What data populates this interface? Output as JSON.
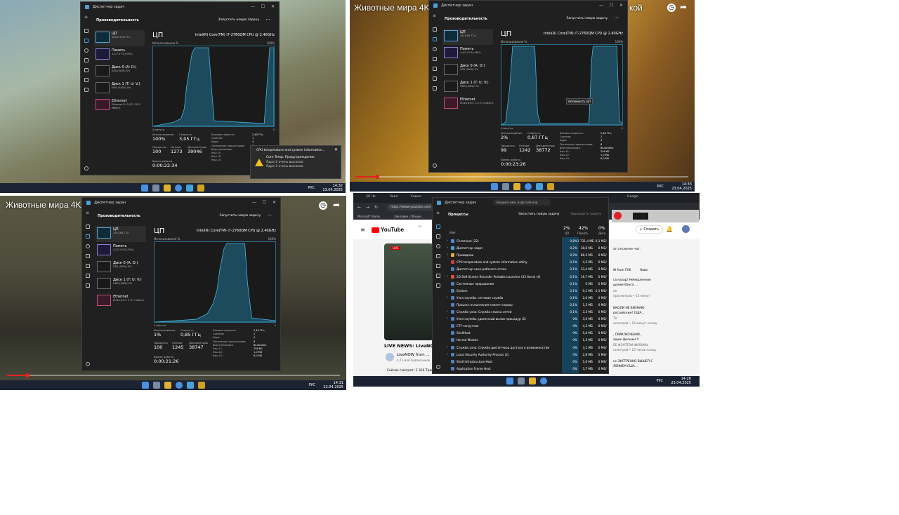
{
  "task_manager": {
    "app_name": "Диспетчер задач",
    "page_performance": "Производительность",
    "page_processes": "Процессы",
    "run_new_task": "Запустить новую задачу",
    "end_task": "Завершить задачу",
    "more": "···",
    "cpu_heading": "ЦП",
    "cpu_name": "Intel(R) Core(TM) i7-2760QM CPU @ 2.40GHz",
    "utilization_label": "Использование %",
    "pct_100": "100%",
    "pct_0": "0",
    "time_axis": "4 минуты",
    "stat_labels": {
      "usage": "Использование",
      "speed": "Скорость",
      "processes": "Процессы",
      "threads": "Потоки",
      "handles": "Дескрипторы",
      "uptime": "Время работы"
    },
    "spec_labels": [
      "Базовая скорость:",
      "Сокетов:",
      "Ядра:",
      "Логических процессоров:",
      "Виртуализация:",
      "Кэш L1:",
      "Кэш L2:",
      "Кэш L3:"
    ],
    "spec_values": [
      "2,40 ГГц",
      "1",
      "4",
      "8",
      "Включено",
      "256 КБ",
      "1,0 МБ",
      "6,0 МБ"
    ]
  },
  "screens": [
    {
      "side_items": [
        {
          "label": "ЦП",
          "sub": "100% 3,05 ГГц"
        },
        {
          "label": "Память",
          "sub": "4,2/7,9 ГБ (53%)"
        },
        {
          "label": "Диск 0 (A: D:)",
          "sub": "SSD (SATA) 0%"
        },
        {
          "label": "Диск 1 (T: U: V:)",
          "sub": "HDD (SATA) 0%"
        },
        {
          "label": "Ethernet",
          "sub": "Ethernet О: 0,0 П: 30,5 Мбит/с"
        }
      ],
      "usage": "100%",
      "speed": "3,05 ГГц",
      "processes": "100",
      "threads": "1273",
      "handles": "39046",
      "uptime": "0:00:22:34",
      "toast": {
        "title": "CPU temperature and system information...",
        "heading": "Core Temp: Предупреждение",
        "line1": "Ядро 2 очень высокая.",
        "line2": "Ядро 3 очень высокая."
      },
      "tray": {
        "lang": "РУС",
        "time": "14:32",
        "date": "23.04.2025"
      }
    },
    {
      "video_title": "Животные мира 4K - За",
      "video_title_tail": "кой",
      "side_items": [
        {
          "label": "ЦП",
          "sub": "2% 0,87 ГГц"
        },
        {
          "label": "Память",
          "sub": "4,4/7,9 ГБ (56%)"
        },
        {
          "label": "Диск 0 (A: D:)",
          "sub": "SSD (SATA) 1%"
        },
        {
          "label": "Диск 1 (T: U: V:)",
          "sub": "HDD (SATA) 0%"
        },
        {
          "label": "Ethernet",
          "sub": "Ethernet О: 0,0 П: 0 кбит/с"
        }
      ],
      "usage": "2%",
      "speed": "0,87 ГГц",
      "processes": "99",
      "threads": "1242",
      "handles": "38772",
      "uptime": "0:00:23:26",
      "tooltip": "Активность ЦП",
      "tray": {
        "lang": "РУС",
        "time": "14:33",
        "date": "23.04.2025"
      }
    },
    {
      "video_title": "Животные мира 4K - За",
      "side_items": [
        {
          "label": "ЦП",
          "sub": "1% 0,85 ГГц"
        },
        {
          "label": "Память",
          "sub": "4,2/7,9 ГБ (53%)"
        },
        {
          "label": "Диск 0 (A: D:)",
          "sub": "SSD (SATA) 0%"
        },
        {
          "label": "Диск 1 (T: U: V:)",
          "sub": "HDD (SATA) 0%"
        },
        {
          "label": "Ethernet",
          "sub": "Ethernet О: 0 П: 0 кбит/с"
        }
      ],
      "usage": "1%",
      "speed": "0,85 ГГц",
      "processes": "100",
      "threads": "1245",
      "handles": "38747",
      "uptime": "0:00:21:26",
      "tray": {
        "lang": "РУС",
        "time": "14:31",
        "date": "23.04.2025"
      }
    },
    {
      "browser": {
        "tabs": [
          "(2) Че",
          "Закл",
          "Самол",
          "Диспетчер задач",
          "Google"
        ],
        "url": "https://www.youtube.com",
        "search_placeholder": "Введите имя, издателя или",
        "bookmarks": [
          "Microsoft Teams",
          "Закладки | Общие..."
        ]
      },
      "youtube": {
        "logo": "YouTube",
        "region": "UA",
        "create": "+ Создать",
        "live": "LIVE",
        "video_title": "LIVE NEWS: LiveNOW",
        "channel": "LiveNOW from ...",
        "subs": "4,73 млн подписчиков",
        "viewing": "Сейчас смотрят: 1 310  Трансляция началась 3 янв. 2024 г.",
        "side_lines": [
          "ат отключен чат.",
          "W from FOX",
          "са назад! Немедленное",
          "щание Вэнса ...",
          "ал",
          "просмотров • 15 минут",
          "ИКОЛИ НЕ ВИЗНАЮ",
          "российским! США...",
          "TV",
          "осмотров • 14 минут назад",
          ", ПРИКЛЮЧЕНИЯ,",
          "ащие фильмы!!!",
          "ЕЕ ФЭНТЕЗИ ФИЛЬМЫ",
          "осмотров • 15 часов назад",
          "нс ЭКСТРЕННО ВЫШЕЛ С",
          "ЛЕНИЕМ США..."
        ],
        "chip_new": "Ново"
      },
      "proc_headers": {
        "name": "Имя",
        "cpu_pct": "2%",
        "cpu": "ЦП",
        "mem_pct": "42%",
        "mem": "Память",
        "disk_pct": "0%",
        "disk": "Диск"
      },
      "processes": [
        {
          "name": "Chromium (22)",
          "cpu": "0,8%",
          "mem": "1 731,4 МБ",
          "disk": "0,1 МБ/с",
          "icon": "#4a8fe0",
          "exp": true
        },
        {
          "name": "Диспетчер задач",
          "cpu": "0,2%",
          "mem": "38,6 МБ",
          "disk": "0 МБ/с",
          "icon": "#4aa0d8",
          "exp": true
        },
        {
          "name": "Проводник",
          "cpu": "0,2%",
          "mem": "88,3 МБ",
          "disk": "0 МБ/с",
          "icon": "#e0b030",
          "exp": true
        },
        {
          "name": "CPU temperature and system information utility",
          "cpu": "0,1%",
          "mem": "4,2 МБ",
          "disk": "0 МБ/с",
          "icon": "#d04040",
          "exp": false
        },
        {
          "name": "Диспетчер окон рабочего стола",
          "cpu": "0,1%",
          "mem": "33,4 МБ",
          "disk": "0 МБ/с",
          "icon": "#5080c0",
          "exp": false
        },
        {
          "name": "2D Soft Screen Recorder Portable Launcher (32 бита) (4)",
          "cpu": "0,1%",
          "mem": "16,7 МБ",
          "disk": "0 МБ/с",
          "icon": "#e05030",
          "exp": true
        },
        {
          "name": "Системные прерывания",
          "cpu": "0,1%",
          "mem": "0 МБ",
          "disk": "0 МБ/с",
          "icon": "#5080c0",
          "exp": false
        },
        {
          "name": "System",
          "cpu": "0,1%",
          "mem": "0,1 МБ",
          "disk": "0,1 МБ/с",
          "icon": "#5080c0",
          "exp": false
        },
        {
          "name": "Узел службы: сетевая служба",
          "cpu": "0,1%",
          "mem": "2,0 МБ",
          "disk": "0 МБ/с",
          "icon": "#5080c0",
          "exp": true
        },
        {
          "name": "Процесс исполнения клиент-сервер",
          "cpu": "0,1%",
          "mem": "1,5 МБ",
          "disk": "0 МБ/с",
          "icon": "#5080c0",
          "exp": false
        },
        {
          "name": "Служба узла: Служба списка сетей",
          "cpu": "0,1%",
          "mem": "3,3 МБ",
          "disk": "0 МБ/с",
          "icon": "#5080c0",
          "exp": true
        },
        {
          "name": "Узел службы удаленный вызов процедур (2)",
          "cpu": "0%",
          "mem": "3,6 МБ",
          "disk": "0 МБ/с",
          "icon": "#5080c0",
          "exp": true
        },
        {
          "name": "CTF-загрузчик",
          "cpu": "0%",
          "mem": "4,3 МБ",
          "disk": "0 МБ/с",
          "icon": "#5080c0",
          "exp": false
        },
        {
          "name": "ShellHost",
          "cpu": "0%",
          "mem": "5,0 МБ",
          "disk": "0 МБ/с",
          "icon": "#5080c0",
          "exp": false
        },
        {
          "name": "Hscmd Module",
          "cpu": "0%",
          "mem": "1,3 МБ",
          "disk": "0 МБ/с",
          "icon": "#5080c0",
          "exp": false
        },
        {
          "name": "Служба узла: Служба диспетчера доступа к возможностям",
          "cpu": "0%",
          "mem": "3,1 МБ",
          "disk": "0 МБ/с",
          "icon": "#5080c0",
          "exp": true
        },
        {
          "name": "Local Security Authority Process (2)",
          "cpu": "0%",
          "mem": "2,8 МБ",
          "disk": "0 МБ/с",
          "icon": "#5080c0",
          "exp": true
        },
        {
          "name": "Shell Infrastructure Host",
          "cpu": "0%",
          "mem": "5,6 МБ",
          "disk": "0 МБ/с",
          "icon": "#5080c0",
          "exp": false
        },
        {
          "name": "Application Frame Host",
          "cpu": "0%",
          "mem": "3,7 МБ",
          "disk": "0 МБ/с",
          "icon": "#5080c0",
          "exp": false
        }
      ],
      "tray": {
        "lang": "РУС",
        "time": "14:26",
        "date": "23.04.2025"
      }
    }
  ],
  "colors": {
    "graph_line": "#4ab8e0",
    "graph_fill": "#1d4a5c",
    "tm_bg": "#202020",
    "accent": "#4aa0d8",
    "progress": "#e52020"
  }
}
